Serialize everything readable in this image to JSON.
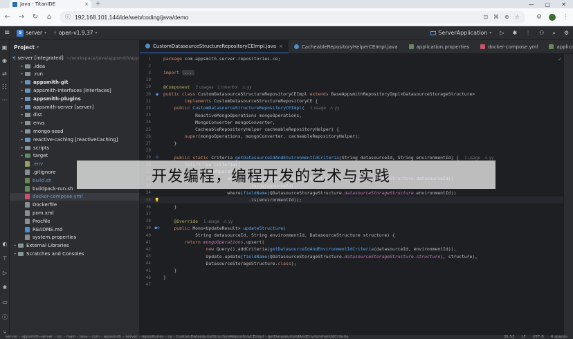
{
  "browser": {
    "tab_title": "Java - TitanIDE",
    "tab_close": "×",
    "new_tab": "+",
    "url": "192.168.101.144/ide/web/coding/java/demo",
    "window_controls": [
      "—",
      "▢",
      "✕"
    ]
  },
  "ide": {
    "project_badge": "S",
    "project_name": "server",
    "branch": "open-v1.9.37",
    "run_config": "ServerApplication"
  },
  "project_panel": {
    "title": "Project",
    "tree": [
      {
        "label": "server [integrated]",
        "hint": "~/workspace/java/appsmith/app",
        "arrow": "▾",
        "icon": "mod",
        "depth": 0,
        "style": ""
      },
      {
        "label": ".idea",
        "arrow": "▸",
        "icon": "folder",
        "depth": 1,
        "style": ""
      },
      {
        "label": ".run",
        "arrow": "▸",
        "icon": "folder",
        "depth": 1,
        "style": ""
      },
      {
        "label": "appsmith-git",
        "arrow": "▸",
        "icon": "mod",
        "depth": 1,
        "style": "bold"
      },
      {
        "label": "appsmith-interfaces [interfaces]",
        "arrow": "▸",
        "icon": "mod",
        "depth": 1,
        "style": ""
      },
      {
        "label": "appsmith-plugins",
        "arrow": "▸",
        "icon": "mod",
        "depth": 1,
        "style": "bold"
      },
      {
        "label": "appsmith-server [server]",
        "arrow": "▸",
        "icon": "mod",
        "depth": 1,
        "style": ""
      },
      {
        "label": "dist",
        "arrow": "▸",
        "icon": "folder",
        "depth": 1,
        "style": ""
      },
      {
        "label": "envs",
        "arrow": "▸",
        "icon": "folder",
        "depth": 1,
        "style": ""
      },
      {
        "label": "mongo-seed",
        "arrow": "▸",
        "icon": "folder",
        "depth": 1,
        "style": ""
      },
      {
        "label": "reactive-caching [reactiveCaching]",
        "arrow": "▸",
        "icon": "mod",
        "depth": 1,
        "style": ""
      },
      {
        "label": "scripts",
        "arrow": "▸",
        "icon": "folder",
        "depth": 1,
        "style": ""
      },
      {
        "label": "target",
        "arrow": "▸",
        "icon": "src",
        "depth": 1,
        "style": ""
      },
      {
        "label": ".env",
        "arrow": "",
        "icon": "env",
        "depth": 1,
        "style": "blue"
      },
      {
        "label": ".gitignore",
        "arrow": "",
        "icon": "file",
        "depth": 1,
        "style": ""
      },
      {
        "label": "build.sh",
        "arrow": "",
        "icon": "sh",
        "depth": 1,
        "style": "blue"
      },
      {
        "label": "buildpack-run.sh",
        "arrow": "",
        "icon": "sh",
        "depth": 1,
        "style": ""
      },
      {
        "label": "docker-compose.yml",
        "arrow": "",
        "icon": "yml",
        "depth": 1,
        "style": "blue",
        "selected": true
      },
      {
        "label": "Dockerfile",
        "arrow": "",
        "icon": "file",
        "depth": 1,
        "style": ""
      },
      {
        "label": "pom.xml",
        "arrow": "",
        "icon": "file",
        "depth": 1,
        "style": ""
      },
      {
        "label": "Procfile",
        "arrow": "",
        "icon": "file",
        "depth": 1,
        "style": ""
      },
      {
        "label": "README.md",
        "arrow": "",
        "icon": "md",
        "depth": 1,
        "style": ""
      },
      {
        "label": "system.properties",
        "arrow": "",
        "icon": "file",
        "depth": 1,
        "style": ""
      },
      {
        "label": "External Libraries",
        "arrow": "▸",
        "icon": "folder",
        "depth": 0,
        "style": ""
      },
      {
        "label": "Scratches and Consoles",
        "arrow": "▸",
        "icon": "folder",
        "depth": 0,
        "style": ""
      }
    ]
  },
  "editor_tabs": [
    {
      "label": "CustomDatasourceStructureRepositoryCEImpl.java",
      "icon": "java",
      "active": true
    },
    {
      "label": "CacheableRepositoryHelperCEImpl.java",
      "icon": "java",
      "active": false
    },
    {
      "label": "application.properties",
      "icon": "props",
      "active": false
    },
    {
      "label": "docker-compose.yml",
      "icon": "yml",
      "active": false
    },
    {
      "label": "application-...",
      "icon": "props",
      "active": false
    }
  ],
  "code_lines": [
    {
      "n": "1",
      "g": "",
      "html": "<span class=\"kw\">package</span> com.appsmith.server.repositories.ce;"
    },
    {
      "n": "2",
      "g": "",
      "html": ""
    },
    {
      "n": "3",
      "g": "",
      "html": "<span class=\"kw\">import</span> <span class=\"fold\">...</span>"
    },
    {
      "n": "18",
      "g": "",
      "html": ""
    },
    {
      "n": "19",
      "g": "",
      "html": "<span class=\"ann\">@Component</span><span class=\"hint\">2 usages   1 inheritor   ⚠ yy</span>"
    },
    {
      "n": "20",
      "g": "●",
      "html": "<span class=\"kw\">public class</span> CustomDatasourceStructureRepositoryCEImpl <span class=\"kw\">extends</span> BaseAppsmithRepositoryImpl&lt;DatasourceStorageStructure&gt;"
    },
    {
      "n": "21",
      "g": "",
      "html": "        <span class=\"kw\">implements</span> CustomDatasourceStructureRepositoryCE {"
    },
    {
      "n": "22",
      "g": "",
      "html": "    <span class=\"kw\">public</span> <span class=\"fn\">CustomDatasourceStructureRepositoryCEImpl</span>(<span class=\"hint\">1 usage   ⚠ yy</span>"
    },
    {
      "n": "23",
      "g": "",
      "html": "            ReactiveMongoOperations mongoOperations,"
    },
    {
      "n": "24",
      "g": "",
      "html": "            MongoConverter mongoConverter,"
    },
    {
      "n": "25",
      "g": "",
      "html": "            CacheableRepositoryHelper cacheableRepositoryHelper) {"
    },
    {
      "n": "26",
      "g": "",
      "html": "        <span class=\"kw\">super</span>(mongoOperations, mongoConverter, cacheableRepositoryHelper);"
    },
    {
      "n": "27",
      "g": "",
      "html": "    }"
    },
    {
      "n": "28",
      "g": "",
      "html": ""
    },
    {
      "n": "29",
      "g": "⊙",
      "html": "    <span class=\"kw\">public static</span> Criteria <span class=\"fn\">getDatasourceIdAndEnvironmentIdCriteria</span>(String datasourceId, String environmentId) {<span class=\"hint\">1 usage   ⚠ yy</span>"
    },
    {
      "n": "30",
      "g": "",
      "html": "        <span class=\"kw\">return new</span> Criteria()"
    },
    {
      "n": "31",
      "g": "",
      "html": "                .andOperator("
    },
    {
      "n": "32",
      "g": "",
      "html": "                        where(<span class=\"fn\">fieldName</span>(QDatasourceStorageStructure.<span class=\"field\">datasourceStorageStructure</span>.datasourceId))"
    },
    {
      "n": "33",
      "g": "",
      "html": "                                .is(datasourceId),"
    },
    {
      "n": "34",
      "g": "",
      "html": "                        where(<span class=\"fn\">fieldName</span>(QDatasourceStorageStructure.<span class=\"field\">datasourceStorageStructure</span>.environmentId))"
    },
    {
      "n": "35",
      "g": "💡",
      "html": "                                .is(environmentId));",
      "current": true
    },
    {
      "n": "36",
      "g": "",
      "html": "    }"
    },
    {
      "n": "37",
      "g": "",
      "html": ""
    },
    {
      "n": "38",
      "g": "",
      "html": "    <span class=\"ann\">@Override</span><span class=\"hint\">1 usage   ⚠ yy</span>"
    },
    {
      "n": "39",
      "g": "●⊙",
      "html": "    <span class=\"kw\">public</span> Mono&lt;UpdateResult&gt; <span class=\"fn\">updateStructure</span>("
    },
    {
      "n": "40",
      "g": "",
      "html": "            String datasourceId, String environmentId, DatasourceStructure structure) {"
    },
    {
      "n": "41",
      "g": "",
      "html": "        <span class=\"kw\">return</span> <span class=\"field\">mongoOperations</span>.upsert("
    },
    {
      "n": "42",
      "g": "",
      "html": "                <span class=\"kw\">new</span> Query().addCriteria(<span class=\"fn\">getDatasourceIdAndEnvironmentIdCriteria</span>(datasourceId, environmentId)),"
    },
    {
      "n": "43",
      "g": "",
      "html": "                Update.update(<span class=\"fn\">fieldName</span>(QDatasourceStorageStructure.<span class=\"field\">datasourceStorageStructure</span>.<span class=\"field\">structure</span>), structure),"
    },
    {
      "n": "44",
      "g": "",
      "html": "                DatasourceStorageStructure.<span class=\"kw\">class</span>);"
    },
    {
      "n": "45",
      "g": "",
      "html": "    }"
    },
    {
      "n": "46",
      "g": "",
      "html": "}"
    },
    {
      "n": "47",
      "g": "",
      "html": ""
    }
  ],
  "overlay": {
    "text": "开发编程，编程开发的艺术与实践"
  },
  "statusbar": {
    "path": "server  ›  appsmith-server  ›  src  ›  main  ›  java  ›  com  ›  appsmith  ›  server  ›  repositories  ›  ce  ›  CustomDatasourceStructureRepositoryCEImpl  ›  getDatasourceIdAndEnvironmentIdCriteria",
    "position": "35:53",
    "line_sep": "LF",
    "encoding": "UTF-8",
    "indent": "4 spaces"
  }
}
